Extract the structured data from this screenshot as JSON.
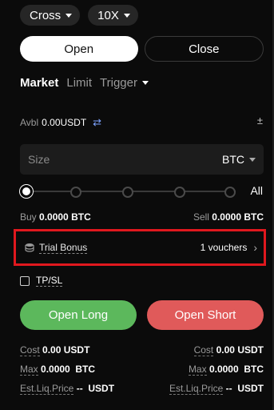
{
  "top": {
    "margin_mode": "Cross",
    "leverage": "10X"
  },
  "order_side_tabs": {
    "open": "Open",
    "close": "Close"
  },
  "order_type": {
    "market": "Market",
    "limit": "Limit",
    "trigger": "Trigger"
  },
  "available": {
    "label": "Avbl",
    "value": "0.00USDT",
    "swap_icon": "⇄",
    "calc_icon": "±"
  },
  "size": {
    "placeholder": "Size",
    "unit": "BTC"
  },
  "slider": {
    "all_label": "All",
    "level": 0
  },
  "buysell": {
    "buy_label": "Buy",
    "buy_value": "0.0000 BTC",
    "sell_label": "Sell",
    "sell_value": "0.0000 BTC"
  },
  "trial_bonus": {
    "label": "Trial Bonus",
    "vouchers": "1 vouchers"
  },
  "tpsl": {
    "label": "TP/SL"
  },
  "actions": {
    "open_long": "Open Long",
    "open_short": "Open Short"
  },
  "info": {
    "cost_label": "Cost",
    "cost_value": "0.00",
    "cost_unit": "USDT",
    "max_label": "Max",
    "max_value": "0.0000",
    "max_unit": "BTC",
    "liq_label": "Est.Liq.Price",
    "liq_value": "--",
    "liq_unit": "USDT"
  },
  "colors": {
    "long": "#5cb85c",
    "short": "#e05a5a",
    "highlight": "#e0181e"
  }
}
